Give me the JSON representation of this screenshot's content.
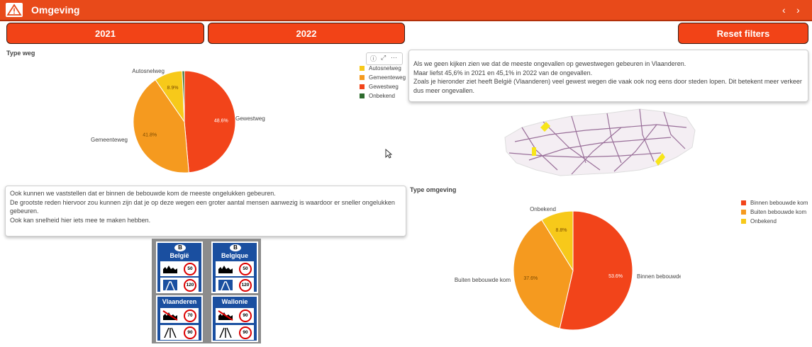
{
  "app": {
    "title": "Omgeving"
  },
  "filters": {
    "year_2021": "2021",
    "year_2022": "2022",
    "reset": "Reset filters"
  },
  "colors": {
    "header": "#e84a1a",
    "button": "#f24317",
    "gewestweg": "#f2441a",
    "gemeenteweg": "#f59a1f",
    "autosnelweg": "#f7c91a",
    "onbekend_road": "#2e6b2e"
  },
  "type_weg": {
    "title": "Type weg",
    "chart_data": {
      "type": "pie",
      "title": "Type weg",
      "categories": [
        "Gewestweg",
        "Gemeenteweg",
        "Autosnelweg",
        "Onbekend"
      ],
      "values": [
        48.6,
        41.8,
        8.9,
        0.7
      ],
      "value_labels": [
        "48.6%",
        "41.8%",
        "8.9%",
        ""
      ],
      "legend_position": "top-right",
      "legend": [
        "Autosnelweg",
        "Gemeenteweg",
        "Gewestweg",
        "Onbekend"
      ]
    }
  },
  "type_omgeving": {
    "title": "Type omgeving",
    "chart_data": {
      "type": "pie",
      "title": "Type omgeving",
      "categories": [
        "Binnen bebouwde kom",
        "Buiten bebouwde kom",
        "Onbekend"
      ],
      "values": [
        53.6,
        37.6,
        8.8
      ],
      "value_labels": [
        "53.6%",
        "37.6%",
        "8.8%"
      ],
      "legend_position": "top-right",
      "legend": [
        "Binnen bebouwde kom",
        "Buiten bebouwde kom",
        "Onbekend"
      ]
    }
  },
  "text_right": {
    "lines": [
      "Als we geen kijken zien we dat de meeste ongevallen op gewestwegen gebeuren in Vlaanderen.",
      "Maar liefst 45,6% in 2021 en 45,1% in 2022 van de ongevallen.",
      "Zoals je hieronder ziet heeft België (Vlaanderen) veel gewest wegen die vaak ook nog eens door steden lopen. Dit betekent meer verkeer",
      "dus meer ongevallen."
    ]
  },
  "text_left": {
    "lines": [
      "Ook kunnen we vaststellen dat er binnen de bebouwde kom de meeste ongelukken gebeuren.",
      "De grootste reden hiervoor zou kunnen zijn dat je op deze wegen een groter aantal mensen aanwezig is waardoor er sneller ongelukken",
      "gebeuren.",
      "Ook kan snelheid hier iets mee te maken hebben."
    ]
  },
  "signs": [
    {
      "country": "B",
      "name": "België",
      "top_speed": "50",
      "bottom_speed": "120"
    },
    {
      "country": "B",
      "name": "Belgique",
      "top_speed": "50",
      "bottom_speed": "120"
    },
    {
      "name": "Vlaanderen",
      "top_speed": "70",
      "bottom_speed": "90"
    },
    {
      "name": "Wallonie",
      "top_speed": "90",
      "bottom_speed": "90"
    }
  ]
}
